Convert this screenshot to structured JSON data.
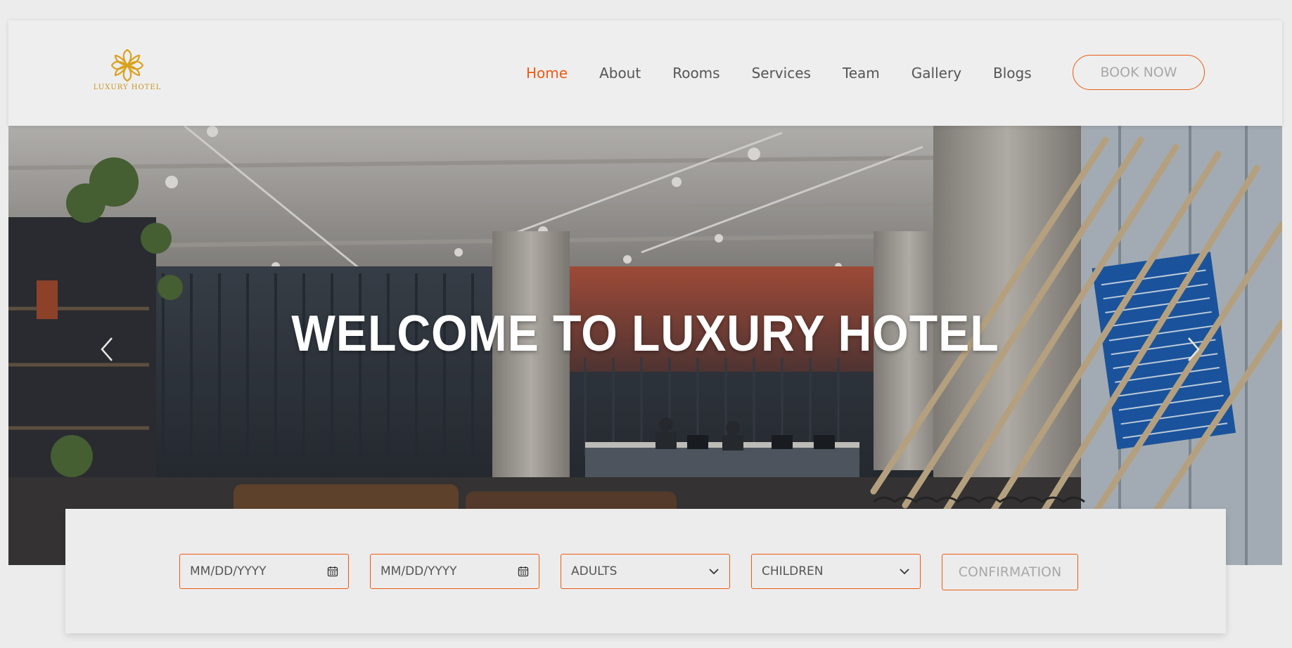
{
  "brand": {
    "logo_text": "LUXURY HOTEL",
    "accent_color": "#ee5a12",
    "logo_color": "#c8961e"
  },
  "nav": {
    "items": [
      {
        "label": "Home",
        "active": true
      },
      {
        "label": "About",
        "active": false
      },
      {
        "label": "Rooms",
        "active": false
      },
      {
        "label": "Services",
        "active": false
      },
      {
        "label": "Team",
        "active": false
      },
      {
        "label": "Gallery",
        "active": false
      },
      {
        "label": "Blogs",
        "active": false
      }
    ],
    "book_label": "BOOK NOW"
  },
  "hero": {
    "title": "WELCOME TO LUXURY HOTEL",
    "prev_icon": "chevron-left-icon",
    "next_icon": "chevron-right-icon"
  },
  "booking": {
    "checkin_placeholder": "MM/DD/YYYY",
    "checkout_placeholder": "MM/DD/YYYY",
    "adults_label": "ADULTS",
    "children_label": "CHILDREN",
    "confirm_label": "CONFIRMATION",
    "date_icon": "calendar-icon",
    "select_icon": "chevron-down-icon"
  }
}
